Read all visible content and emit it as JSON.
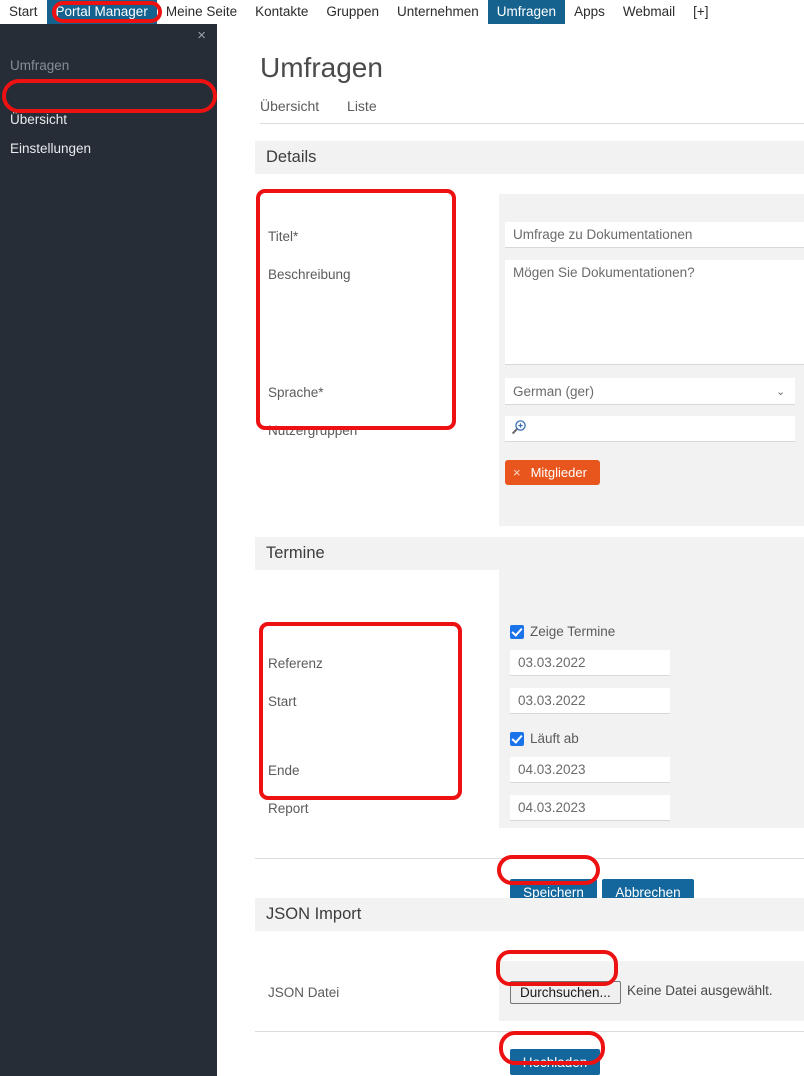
{
  "topnav": {
    "items": [
      {
        "label": "Start",
        "active": false
      },
      {
        "label": "Portal Manager",
        "active": true
      },
      {
        "label": "Meine Seite",
        "active": false
      },
      {
        "label": "Kontakte",
        "active": false
      },
      {
        "label": "Gruppen",
        "active": false
      },
      {
        "label": "Unternehmen",
        "active": false
      },
      {
        "label": "Umfragen",
        "active": true
      },
      {
        "label": "Apps",
        "active": false
      },
      {
        "label": "Webmail",
        "active": false
      },
      {
        "label": "[+]",
        "active": false
      }
    ],
    "start_label": "Start",
    "portal_manager_label": "Portal Manager",
    "meine_seite_label": "Meine Seite",
    "kontakte_label": "Kontakte",
    "gruppen_label": "Gruppen",
    "unternehmen_label": "Unternehmen",
    "umfragen_label": "Umfragen",
    "apps_label": "Apps",
    "webmail_label": "Webmail",
    "plus_label": "[+]"
  },
  "sidebar": {
    "close_icon": "×",
    "section_label": "Umfragen",
    "items": [
      {
        "label": "Übersicht"
      },
      {
        "label": "Einstellungen"
      }
    ]
  },
  "main": {
    "page_title": "Umfragen",
    "tabs": [
      {
        "label": "Übersicht"
      },
      {
        "label": "Liste"
      }
    ]
  },
  "details": {
    "header": "Details",
    "titel_label": "Titel*",
    "titel_value": "Umfrage zu Dokumentationen",
    "beschreibung_label": "Beschreibung",
    "beschreibung_value": "Mögen Sie Dokumentationen?",
    "sprache_label": "Sprache*",
    "sprache_value": "German (ger)",
    "sprache_chevron": "⌄",
    "nutzergruppen_label": "Nutzergruppen",
    "nutzergruppen_search_value": "",
    "search_icon": "zoom-in-icon",
    "tag_remove_icon": "×",
    "tag_label": "Mitglieder"
  },
  "termine": {
    "header": "Termine",
    "zeige_termine_label": "Zeige Termine",
    "zeige_termine_checked": true,
    "referenz_label": "Referenz",
    "referenz_value": "03.03.2022",
    "start_label": "Start",
    "start_value": "03.03.2022",
    "laeuft_ab_label": "Läuft ab",
    "laeuft_ab_checked": true,
    "ende_label": "Ende",
    "ende_value": "04.03.2023",
    "report_label": "Report",
    "report_value": "04.03.2023"
  },
  "actions": {
    "speichern_label": "Speichern",
    "abbrechen_label": "Abbrechen"
  },
  "json_import": {
    "header": "JSON Import",
    "datei_label": "JSON Datei",
    "browse_label": "Durchsuchen...",
    "file_status": "Keine Datei ausgewählt.",
    "hochladen_label": "Hochladen"
  },
  "colors": {
    "nav_active": "#15628f",
    "sidebar_bg": "#262d36",
    "panel_bg": "#f2f2f2",
    "button_blue": "#14679c",
    "tag_orange": "#e8561e",
    "checkbox_blue": "#1a73e8",
    "annotation_red": "#ee1111"
  }
}
